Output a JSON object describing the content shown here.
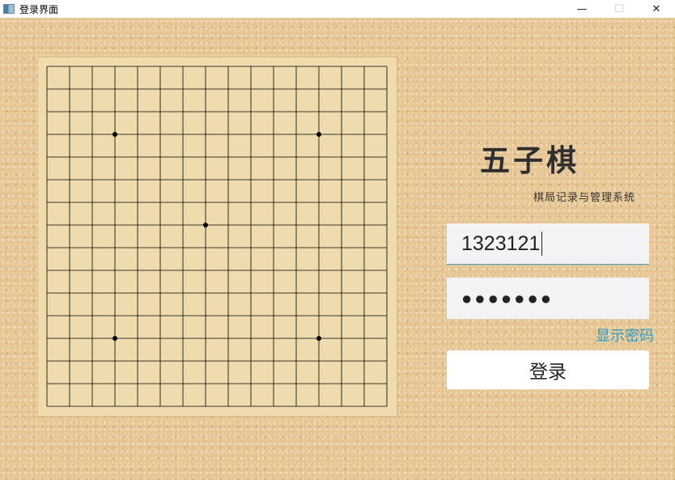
{
  "window": {
    "title": "登录界面",
    "controls": {
      "minimize": "—",
      "maximize": "☐",
      "close": "✕"
    }
  },
  "board": {
    "size": 15,
    "star_points": [
      [
        3,
        3
      ],
      [
        3,
        12
      ],
      [
        7,
        7
      ],
      [
        12,
        3
      ],
      [
        12,
        12
      ]
    ],
    "line_color": "#000000",
    "background_color": "#eedbae"
  },
  "header": {
    "title": "五子棋",
    "subtitle": "棋局记录与管理系统"
  },
  "form": {
    "username_value": "1323121",
    "password_masked": "●●●●●●●",
    "show_password_label": "显示密码",
    "login_label": "登录",
    "accent_color": "#2a9dcb"
  }
}
